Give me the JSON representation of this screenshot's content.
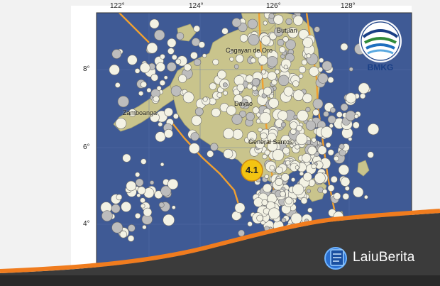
{
  "map": {
    "lon_ticks": [
      "122°",
      "124°",
      "126°",
      "128°"
    ],
    "lat_ticks": [
      "8°",
      "6°",
      "4°"
    ],
    "cities": [
      "Butuan",
      "Cagayan de Oro",
      "Zamboanga",
      "Davao",
      "General Santos"
    ],
    "logo_text": "BMKG",
    "magnitude": "4.1",
    "colors": {
      "sea": "#3f5a95",
      "land": "#c9c48c",
      "fault": "#f0a030",
      "quake_fill": "#f3f2e4",
      "epicenter": "#f3c412"
    }
  },
  "brand": {
    "name": "LaiuBerita",
    "icon": "newspaper-globe-icon"
  }
}
